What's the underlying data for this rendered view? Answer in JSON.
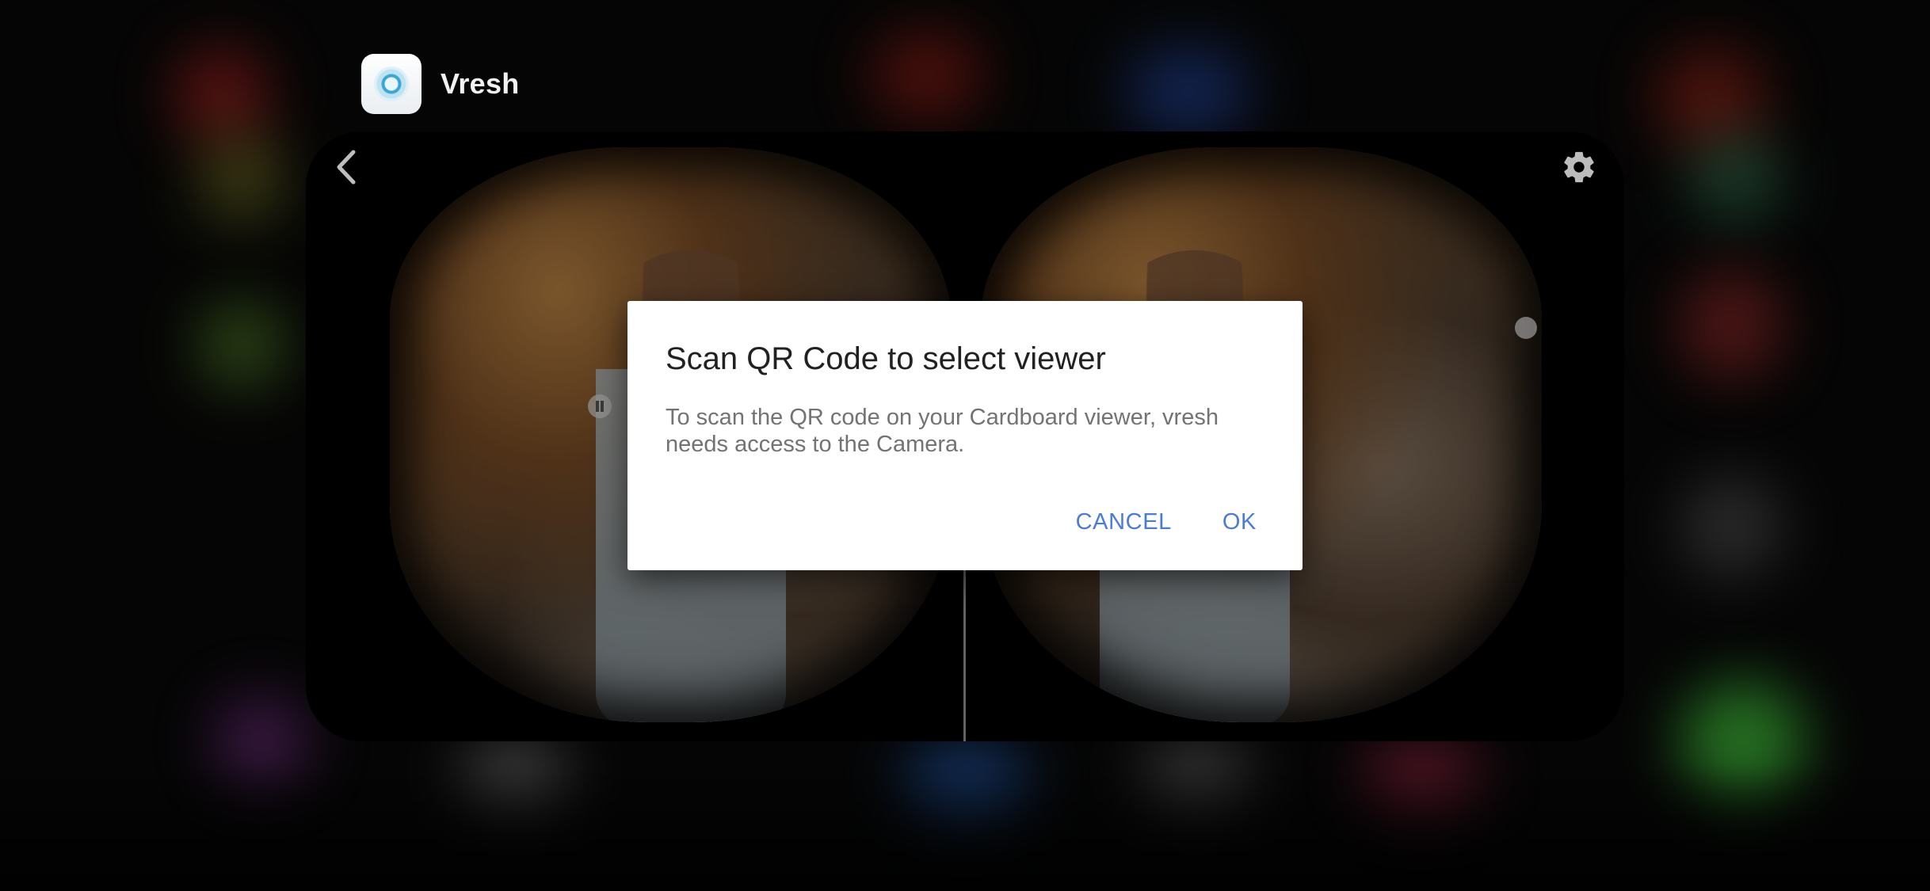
{
  "app_switcher": {
    "app_name": "Vresh",
    "app_icon": "vresh-app-icon"
  },
  "vr_view": {
    "back_icon": "chevron-left-icon",
    "settings_icon": "gear-icon"
  },
  "dialog": {
    "title": "Scan QR Code to select viewer",
    "message": "To scan the QR code on your Cardboard viewer, vresh needs access to the Camera.",
    "cancel_label": "CANCEL",
    "ok_label": "OK"
  },
  "colors": {
    "accent": "#4a7bd6",
    "dialog_bg": "#ffffff",
    "title_text": "#212121",
    "body_text": "#737373"
  }
}
